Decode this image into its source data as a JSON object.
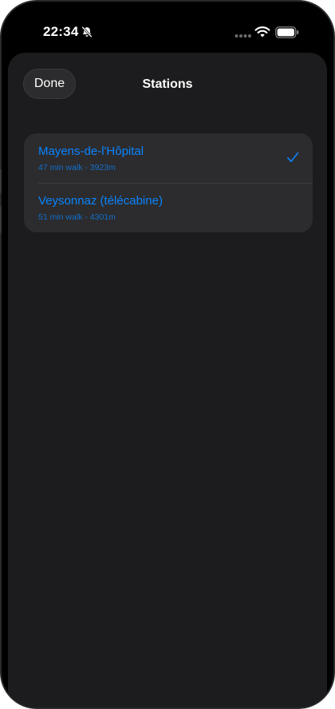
{
  "status_bar": {
    "time": "22:34",
    "icons": [
      "bell-slash-icon",
      "cellular-signal-icon",
      "wifi-icon",
      "battery-icon"
    ]
  },
  "sheet": {
    "done_label": "Done",
    "title": "Stations"
  },
  "stations": [
    {
      "name": "Mayens-de-l'Hôpital",
      "detail": "47 min walk - 3923m",
      "selected": true
    },
    {
      "name": "Veysonnaz (télécabine)",
      "detail": "51 min walk - 4301m",
      "selected": false
    }
  ],
  "colors": {
    "accent": "#0a84ff",
    "sheet_background": "#1c1c1e",
    "card_background": "#2c2c2e"
  }
}
